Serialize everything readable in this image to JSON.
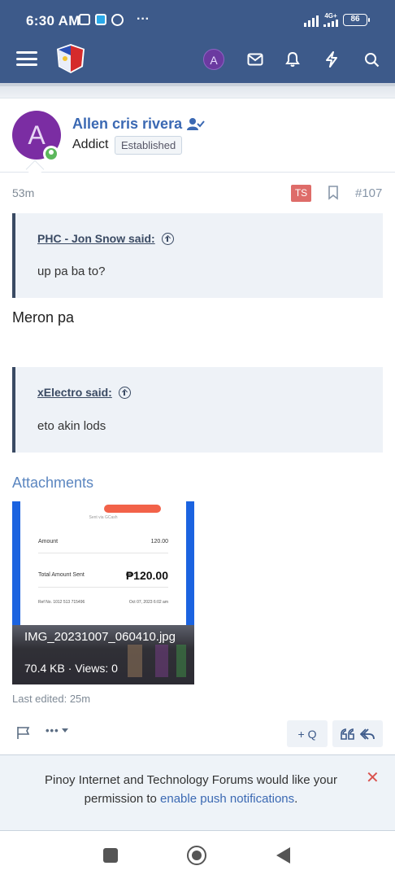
{
  "status_bar": {
    "time": "6:30 AM",
    "network": "4G+",
    "battery": "86"
  },
  "header": {
    "user_initial": "A"
  },
  "post": {
    "author": {
      "name": "Allen cris rivera",
      "initial": "A",
      "title": "Addict",
      "badge": "Established",
      "online": true
    },
    "time": "53m",
    "ts_label": "TS",
    "number": "#107",
    "quotes": [
      {
        "author": "PHC - Jon Snow said:",
        "text": "up pa ba to?"
      },
      {
        "author": "xElectro said:",
        "text": "eto akin lods"
      }
    ],
    "message": "Meron pa",
    "attachments_title": "Attachments",
    "attachment": {
      "filename": "IMG_20231007_060410.jpg",
      "meta": "70.4 KB · Views: 0",
      "receipt": {
        "sent_via": "Sent via GCash",
        "amount_label": "Amount",
        "amount_value": "120.00",
        "total_label": "Total Amount Sent",
        "total_value": "₱120.00",
        "ref_label": "Ref No. 1012 513 715496",
        "ref_date": "Oct 07, 2023 6:02 am"
      }
    },
    "last_edited": "Last edited: 25m",
    "actions": {
      "more_label": "•••",
      "quote_button": "+ Q"
    }
  },
  "notice": {
    "text_before": "Pinoy Internet and Technology Forums would like your permission to ",
    "link": "enable push notifications",
    "text_after": "."
  },
  "colors": {
    "header_bg": "#3d5a8a",
    "username": "#3b69b3",
    "avatar": "#7b2da3",
    "ts_badge": "#d9534f",
    "quote_bg": "#eef2f7"
  }
}
